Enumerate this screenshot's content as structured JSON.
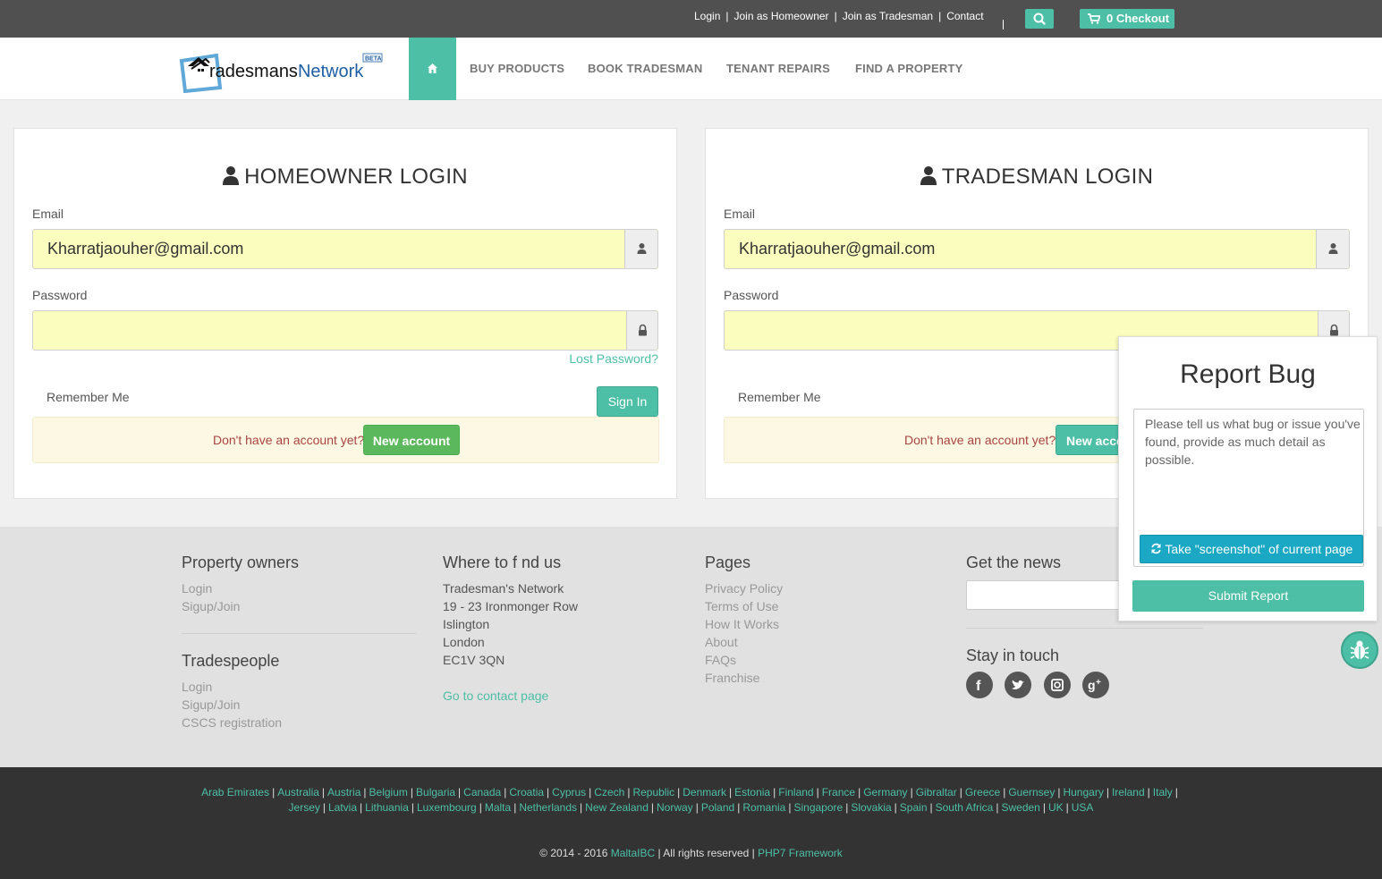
{
  "topbar": {
    "links": [
      "Login",
      "Join as Homeowner",
      "Join as Tradesman",
      "Contact"
    ],
    "separator": "|",
    "checkout": "0 Checkout"
  },
  "nav": {
    "logo_text": "radesmansNetwork",
    "logo_badge": "BETA",
    "items": [
      "BUY PRODUCTS",
      "BOOK TRADESMAN",
      "TENANT REPAIRS",
      "FIND A PROPERTY"
    ]
  },
  "homeowner": {
    "title": "HOMEOWNER LOGIN",
    "email_label": "Email",
    "email_value": "Kharratjaouher@gmail.com",
    "password_label": "Password",
    "lost_password": "Lost Password?",
    "remember": "Remember Me",
    "signin": "Sign In",
    "no_account": "Don't have an account yet?",
    "new_account": "New account"
  },
  "tradesman": {
    "title": "TRADESMAN LOGIN",
    "email_label": "Email",
    "email_value": "Kharratjaouher@gmail.com",
    "password_label": "Password",
    "remember": "Remember Me",
    "no_account": "Don't have an account yet?",
    "new_account": "New acco"
  },
  "footer": {
    "property_owners": {
      "title": "Property owners",
      "links": [
        "Login",
        "Sigup/Join"
      ]
    },
    "tradespeople": {
      "title": "Tradespeople",
      "links": [
        "Login",
        "Sigup/Join",
        "CSCS registration"
      ]
    },
    "where": {
      "title": "Where to f nd us",
      "lines": [
        "Tradesman's Network",
        "19 - 23 Ironmonger Row",
        "Islington",
        "London",
        "EC1V 3QN"
      ],
      "contact_link": "Go to contact page"
    },
    "pages": {
      "title": "Pages",
      "links": [
        "Privacy Policy",
        "Terms of Use",
        "How It Works",
        "About",
        "FAQs",
        "Franchise"
      ]
    },
    "news": {
      "title": "Get the news"
    },
    "stay": {
      "title": "Stay in touch"
    }
  },
  "countries_row1": [
    "Arab Emirates",
    "Australia",
    "Austria",
    "Belgium",
    "Bulgaria",
    "Canada",
    "Croatia",
    "Cyprus",
    "Czech",
    "Republic",
    "Denmark",
    "Estonia",
    "Finland",
    "France",
    "Germany",
    "Gibraltar",
    "Greece",
    "Guernsey",
    "Hungary",
    "Ireland",
    "Italy"
  ],
  "countries_row2": [
    "Jersey",
    "Latvia",
    "Lithuania",
    "Luxembourg",
    "Malta",
    "Netherlands",
    "New Zealand",
    "Norway",
    "Poland",
    "Romania",
    "Singapore",
    "Slovakia",
    "Spain",
    "South Africa",
    "Sweden",
    "UK",
    "USA"
  ],
  "copyright": {
    "prefix": "© 2014 - 2016",
    "company": "MaltaIBC",
    "middle": "| All rights reserved |",
    "framework": "PHP7 Framework"
  },
  "bug": {
    "title": "Report Bug",
    "placeholder": "Please tell us what bug or issue you've found, provide as much detail as possible.",
    "screenshot_button": "Take \"screenshot\" of current page",
    "submit": "Submit Report"
  },
  "colors": {
    "accent": "#4dbfa6",
    "topbar": "#505050",
    "bottombar": "#333333",
    "field_bg": "#fafdbd",
    "green": "#5cb85c",
    "screenshot_blue": "#1aa8c4"
  }
}
